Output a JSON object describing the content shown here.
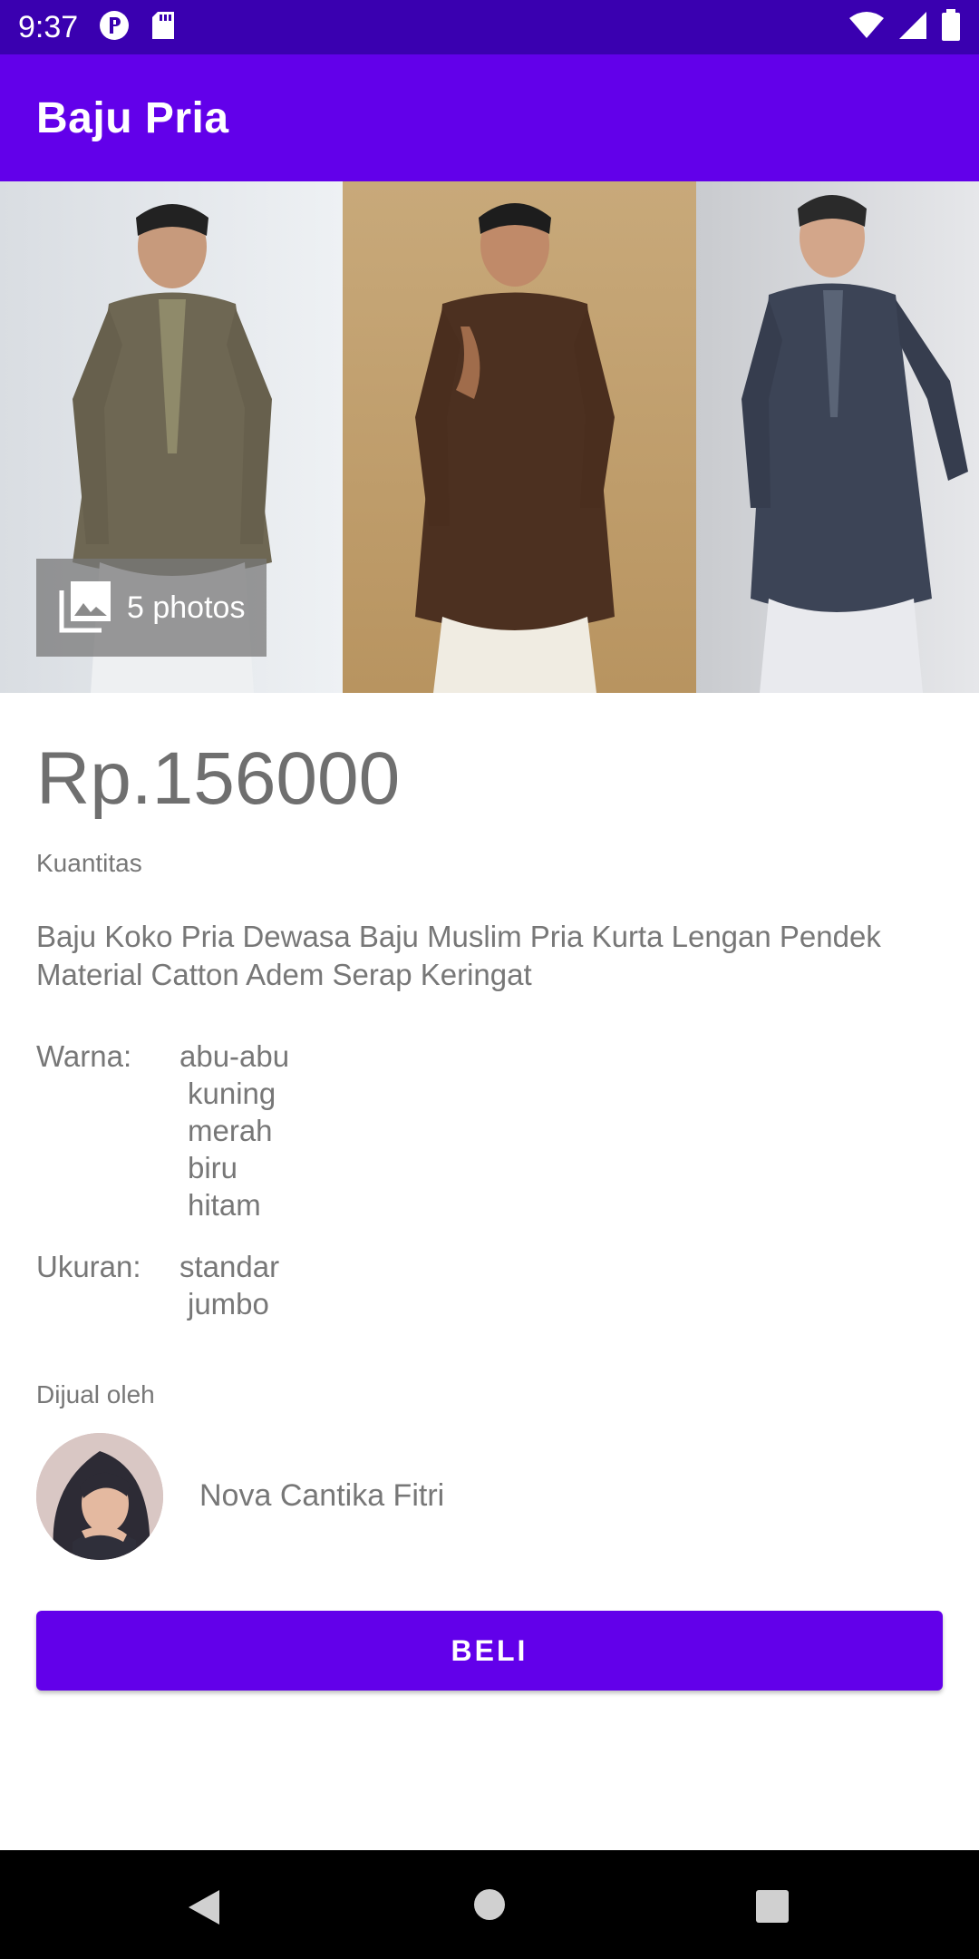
{
  "status_bar": {
    "time": "9:37",
    "icons": [
      "p-badge-icon",
      "sd-card-icon",
      "wifi-icon",
      "signal-icon",
      "battery-icon"
    ]
  },
  "app_bar": {
    "title": "Baju Pria",
    "color": "#6200ea"
  },
  "gallery": {
    "photo_count_label": "5 photos"
  },
  "product": {
    "price": "Rp.156000",
    "quantity_label": "Kuantitas",
    "description": "Baju Koko Pria Dewasa Baju Muslim Pria Kurta Lengan Pendek Material Catton Adem Serap Keringat",
    "color_label": "Warna:",
    "colors": [
      "abu-abu",
      "kuning",
      "merah",
      "biru",
      "hitam"
    ],
    "size_label": "Ukuran:",
    "sizes": [
      "standar",
      "jumbo"
    ]
  },
  "seller": {
    "label": "Dijual oleh",
    "name": "Nova Cantika Fitri"
  },
  "actions": {
    "buy_label": "BELI"
  },
  "nav_bar": {
    "icons": [
      "back-icon",
      "home-icon",
      "recents-icon"
    ]
  }
}
